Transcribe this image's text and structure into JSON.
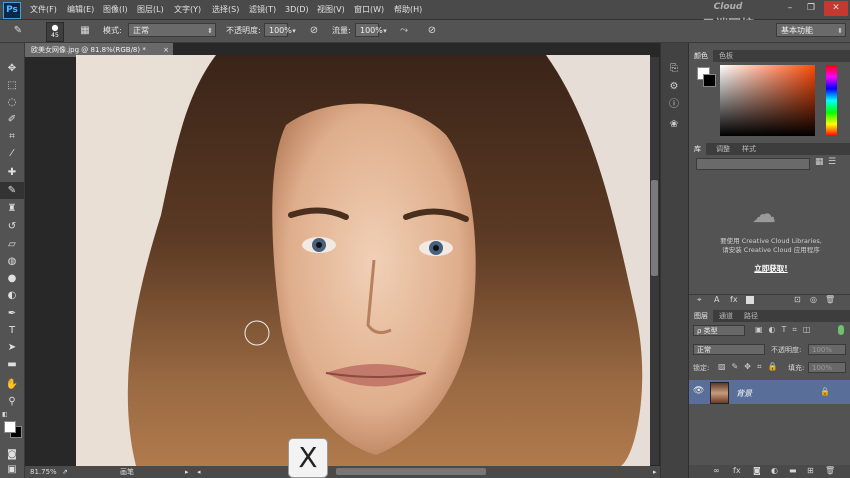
{
  "menu": {
    "logo": "Ps",
    "items": [
      "文件(F)",
      "编辑(E)",
      "图像(I)",
      "图层(L)",
      "文字(Y)",
      "选择(S)",
      "滤镜(T)",
      "3D(D)",
      "视图(V)",
      "窗口(W)",
      "帮助(H)"
    ],
    "window_min": "–",
    "window_restore": "❐",
    "window_close": "✕"
  },
  "options": {
    "brush_size": "45",
    "mode_label": "模式:",
    "mode_value": "正常",
    "opacity_label": "不透明度:",
    "opacity_value": "100%",
    "flow_label": "流量:",
    "flow_value": "100%",
    "workspace_value": "基本功能"
  },
  "watermark": {
    "cloud": "Cloud",
    "name": "云端网校"
  },
  "document": {
    "tab_title": "欧美女网像.jpg @ 81.8%(RGB/8) *",
    "tab_close": "×",
    "zoom": "81.75%",
    "status_tool": "画笔"
  },
  "overlay_key": "X",
  "panels": {
    "color_tabs": [
      "颜色",
      "色板"
    ],
    "library_tabs": [
      "库",
      "调整",
      "样式"
    ],
    "library_msg1": "要使用 Creative Cloud Libraries,",
    "library_msg2": "请安装 Creative Cloud 应用程序",
    "library_link": "立即获取!",
    "layers_tabs": [
      "图层",
      "通道",
      "路径"
    ],
    "filter_kind": "ρ 类型",
    "blend_mode": "正常",
    "opacity_label": "不透明度:",
    "opacity_value": "100%",
    "lock_label": "锁定:",
    "fill_label": "填充:",
    "fill_value": "100%",
    "layer_name": "背景"
  },
  "colors": {
    "foreground": "#ffffff",
    "background": "#000000",
    "accent_layer": "#596f99"
  }
}
